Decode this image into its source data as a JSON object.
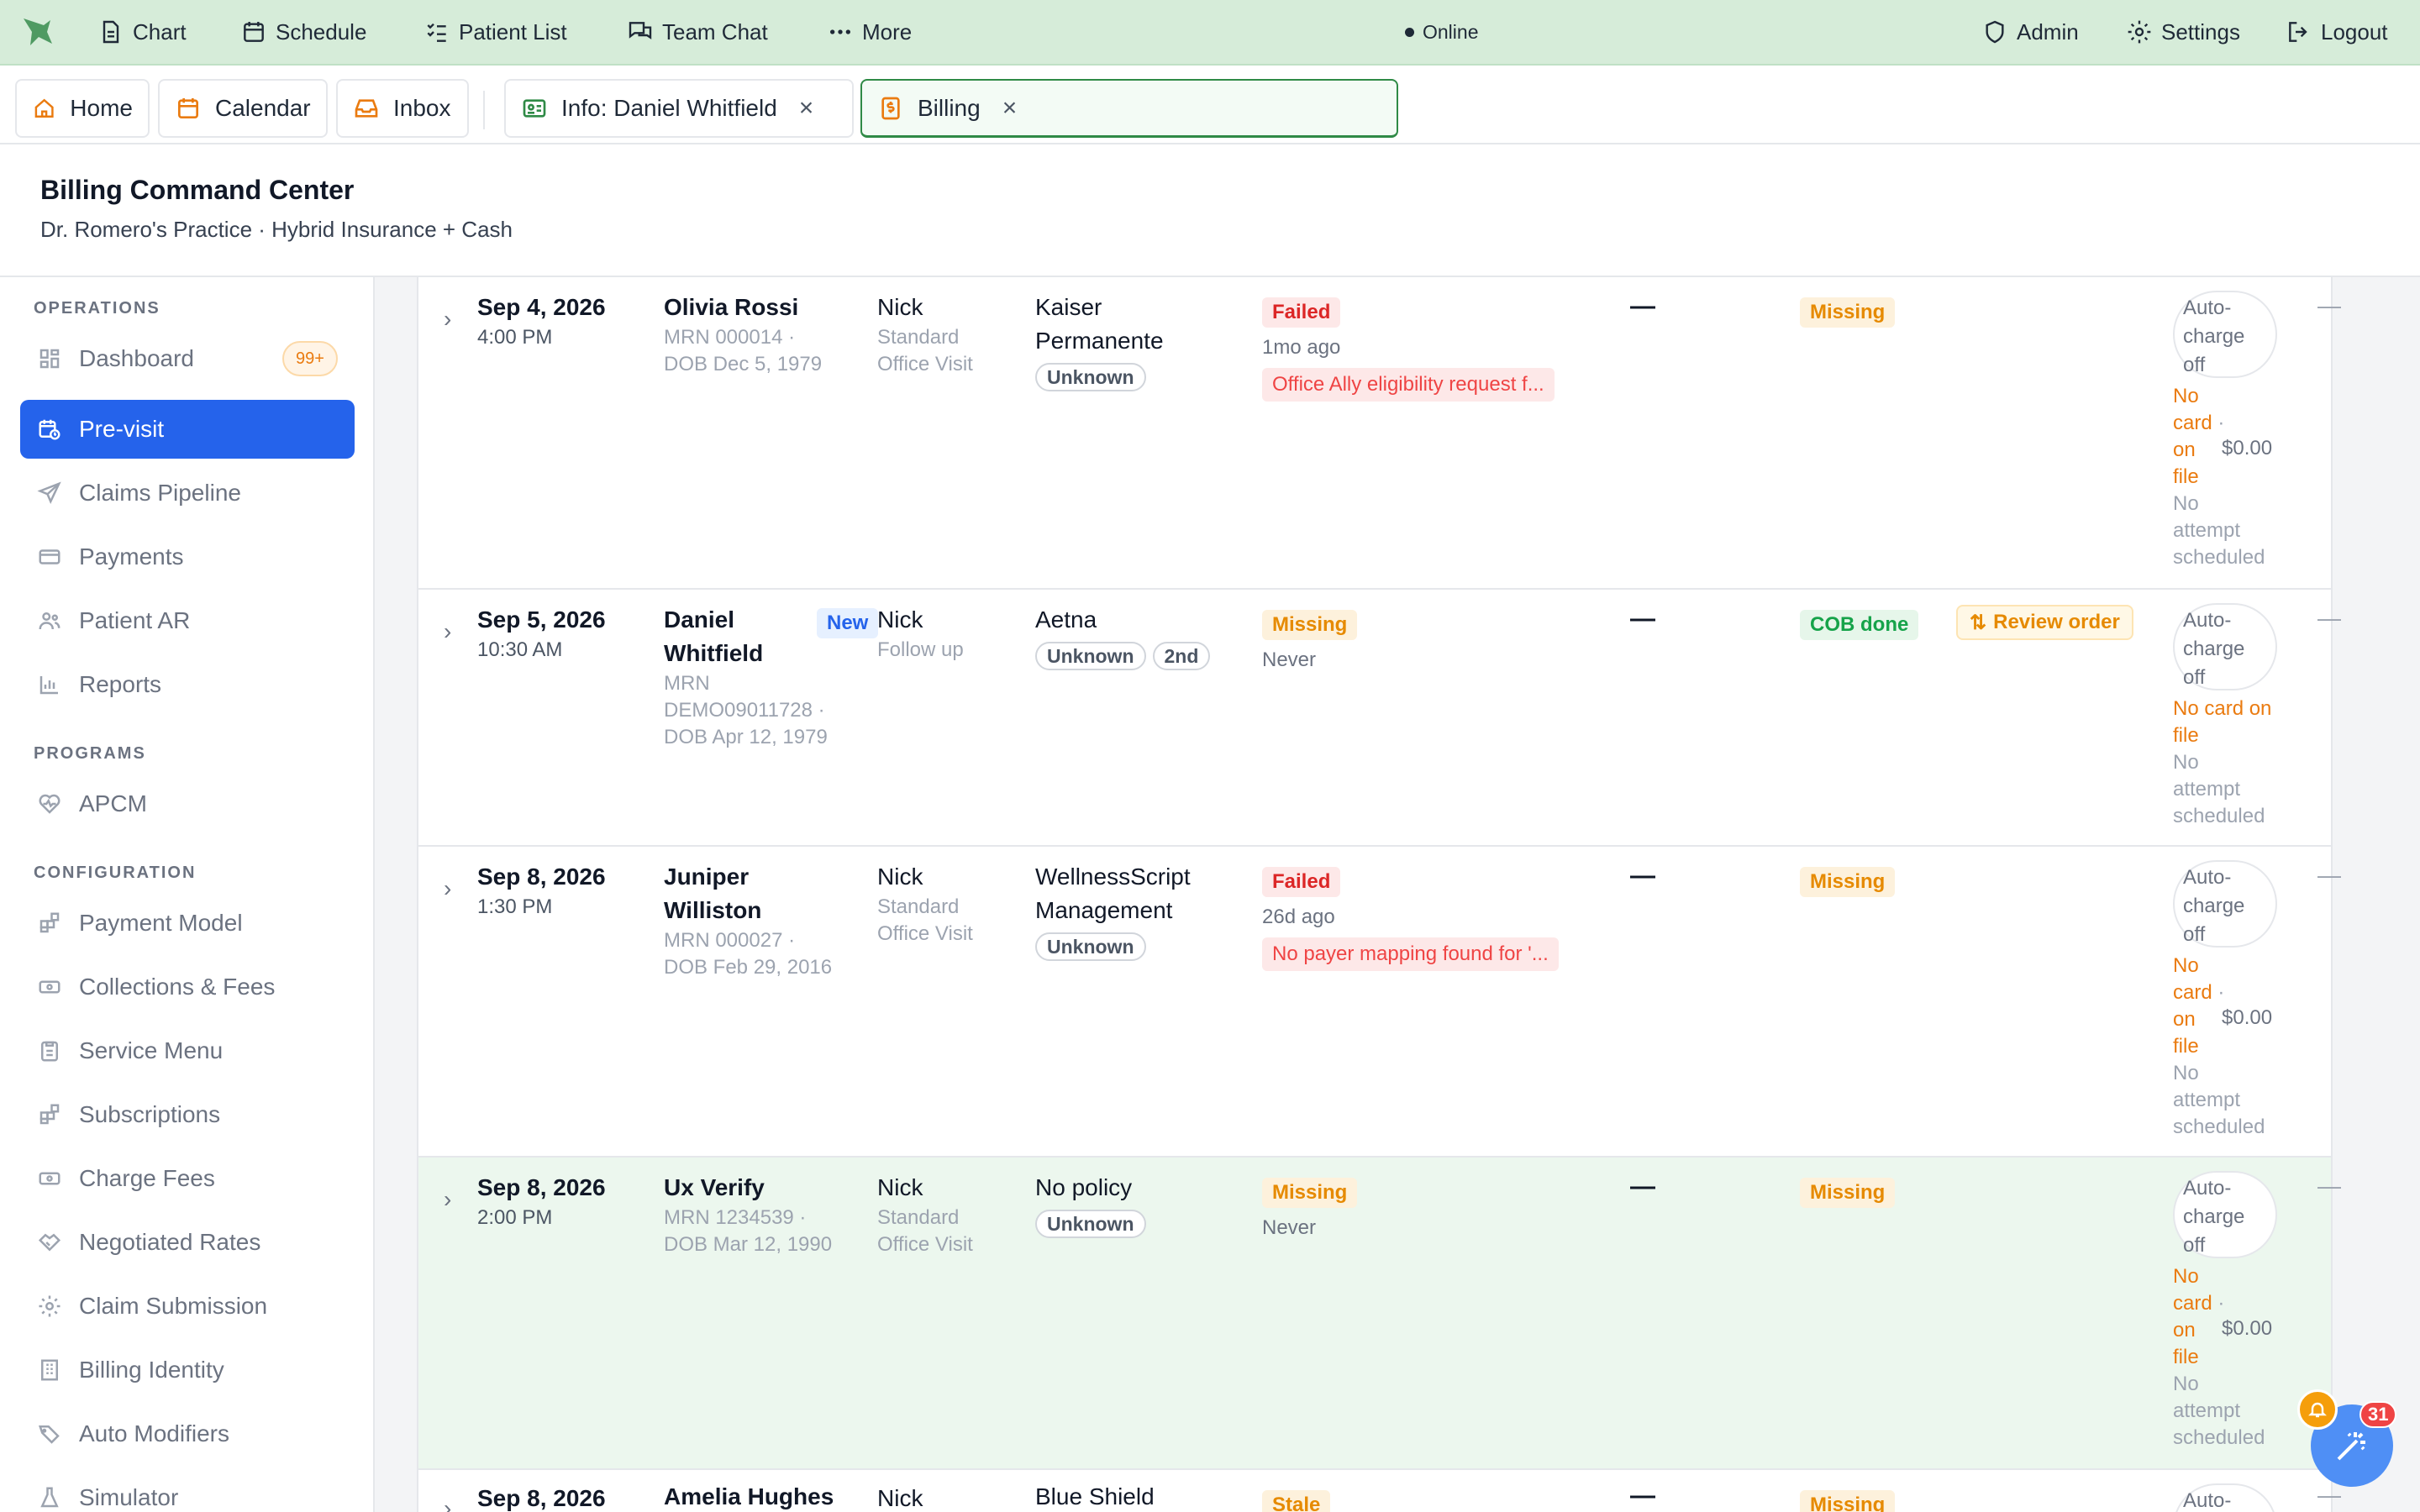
{
  "menubar": {
    "items": [
      "Chart",
      "Schedule",
      "Patient List",
      "Team Chat",
      "More"
    ],
    "status": "Online",
    "right": [
      "Admin",
      "Settings",
      "Logout"
    ]
  },
  "tabs": {
    "pinned": [
      "Home",
      "Calendar",
      "Inbox"
    ],
    "open": [
      {
        "label": "Info: Daniel Whitfield",
        "close": "×"
      },
      {
        "label": "Billing",
        "close": "×"
      }
    ]
  },
  "header": {
    "title": "Billing Command Center",
    "subtitle": "Dr. Romero's Practice · Hybrid Insurance + Cash"
  },
  "sidebar": {
    "sections": [
      "OPERATIONS",
      "PROGRAMS",
      "CONFIGURATION"
    ],
    "operations": [
      "Dashboard",
      "Pre-visit",
      "Claims Pipeline",
      "Payments",
      "Patient AR",
      "Reports"
    ],
    "dashboard_badge": "99+",
    "programs": [
      "APCM"
    ],
    "configuration": [
      "Payment Model",
      "Collections & Fees",
      "Service Menu",
      "Subscriptions",
      "Charge Fees",
      "Negotiated Rates",
      "Claim Submission",
      "Billing Identity",
      "Auto Modifiers",
      "Simulator"
    ]
  },
  "rows": [
    {
      "date": "Sep 4, 2026",
      "time": "4:00 PM",
      "patient": "Olivia Rossi",
      "mrn": "MRN 000014 ·",
      "dob": "DOB Dec 5, 1979",
      "provider": "Nick",
      "visit1": "Standard",
      "visit2": "Office Visit",
      "payer1": "Kaiser",
      "payer2": "Permanente",
      "payer_tag": "Unknown",
      "elig_status": "Failed",
      "elig_ago": "1mo ago",
      "elig_error": "Office Ally eligibility request f...",
      "dash": "—",
      "cob": "Missing",
      "auto1": "Auto-",
      "auto2": "charge",
      "auto3": "off",
      "card": [
        "No",
        "card",
        "on",
        "file"
      ],
      "dot": "·",
      "amount": "$0.00",
      "attempt": [
        "No",
        "attempt",
        "scheduled"
      ],
      "last": "—"
    },
    {
      "date": "Sep 5, 2026",
      "time": "10:30 AM",
      "patient1": "Daniel",
      "patient2": "Whitfield",
      "new": "New",
      "mrn1": "MRN",
      "mrn2": "DEMO09011728 ·",
      "dob": "DOB Apr 12, 1979",
      "provider": "Nick",
      "visit1": "Follow up",
      "payer1": "Aetna",
      "payer_tag": "Unknown",
      "payer_tag2": "2nd",
      "elig_status": "Missing",
      "elig_ago": "Never",
      "dash": "—",
      "cob": "COB done",
      "review": "Review order",
      "auto1": "Auto-",
      "auto2": "charge",
      "auto3": "off",
      "card1": "No card on",
      "card2": "file",
      "attempt": [
        "No",
        "attempt",
        "scheduled"
      ],
      "last": "—"
    },
    {
      "date": "Sep 8, 2026",
      "time": "1:30 PM",
      "patient1": "Juniper",
      "patient2": "Williston",
      "mrn": "MRN 000027 ·",
      "dob": "DOB Feb 29, 2016",
      "provider": "Nick",
      "visit1": "Standard",
      "visit2": "Office Visit",
      "payer1": "WellnessScript",
      "payer2": "Management",
      "payer_tag": "Unknown",
      "elig_status": "Failed",
      "elig_ago": "26d ago",
      "elig_error": "No payer mapping found for '...",
      "dash": "—",
      "cob": "Missing",
      "auto1": "Auto-",
      "auto2": "charge",
      "auto3": "off",
      "card": [
        "No",
        "card",
        "on",
        "file"
      ],
      "dot": "·",
      "amount": "$0.00",
      "attempt": [
        "No",
        "attempt",
        "scheduled"
      ],
      "last": "—"
    },
    {
      "date": "Sep 8, 2026",
      "time": "2:00 PM",
      "patient": "Ux Verify",
      "mrn": "MRN 1234539 ·",
      "dob": "DOB Mar 12, 1990",
      "provider": "Nick",
      "visit1": "Standard",
      "visit2": "Office Visit",
      "payer1": "No policy",
      "payer_tag": "Unknown",
      "elig_status": "Missing",
      "elig_ago": "Never",
      "dash": "—",
      "cob": "Missing",
      "auto1": "Auto-",
      "auto2": "charge",
      "auto3": "off",
      "card": [
        "No",
        "card",
        "on",
        "file"
      ],
      "dot": "·",
      "amount": "$0.00",
      "attempt": [
        "No",
        "attempt",
        "scheduled"
      ],
      "last": "—"
    },
    {
      "date": "Sep 8, 2026",
      "patient": "Amelia Hughes",
      "provider": "Nick",
      "payer1": "Blue Shield",
      "elig_status": "Stale",
      "dash": "—",
      "cob": "Missing",
      "auto1": "Auto-",
      "last": "—"
    }
  ],
  "floating": {
    "count": "31"
  },
  "colors": {
    "topbar": "#d6ecd9",
    "accent": "#2563eb",
    "active_tab_border": "#2f8a46",
    "highlight_row": "#ecf7ee"
  }
}
